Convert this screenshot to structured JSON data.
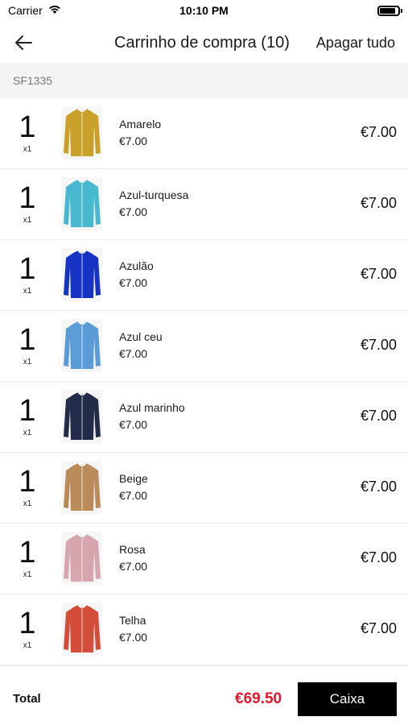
{
  "status": {
    "carrier": "Carrier",
    "time": "10:10 PM",
    "battery_level": 0.85
  },
  "nav": {
    "title": "Carrinho de compra (10)",
    "clear_all": "Apagar tudo"
  },
  "section": {
    "code": "SF1335"
  },
  "items": [
    {
      "qty": "1",
      "mult": "x1",
      "name": "Amarelo",
      "unit_price": "€7.00",
      "price": "€7.00",
      "color": "#c9a12a"
    },
    {
      "qty": "1",
      "mult": "x1",
      "name": "Azul-turquesa",
      "unit_price": "€7.00",
      "price": "€7.00",
      "color": "#48b8cf"
    },
    {
      "qty": "1",
      "mult": "x1",
      "name": "Azulão",
      "unit_price": "€7.00",
      "price": "€7.00",
      "color": "#1733c4"
    },
    {
      "qty": "1",
      "mult": "x1",
      "name": "Azul ceu",
      "unit_price": "€7.00",
      "price": "€7.00",
      "color": "#5b9bd6"
    },
    {
      "qty": "1",
      "mult": "x1",
      "name": "Azul marinho",
      "unit_price": "€7.00",
      "price": "€7.00",
      "color": "#222b47"
    },
    {
      "qty": "1",
      "mult": "x1",
      "name": "Beige",
      "unit_price": "€7.00",
      "price": "€7.00",
      "color": "#b98b58"
    },
    {
      "qty": "1",
      "mult": "x1",
      "name": "Rosa",
      "unit_price": "€7.00",
      "price": "€7.00",
      "color": "#d6a5ae"
    },
    {
      "qty": "1",
      "mult": "x1",
      "name": "Telha",
      "unit_price": "€7.00",
      "price": "€7.00",
      "color": "#d24d3a"
    }
  ],
  "footer": {
    "total_label": "Total",
    "total_value": "€69.50",
    "checkout_label": "Caixa"
  }
}
